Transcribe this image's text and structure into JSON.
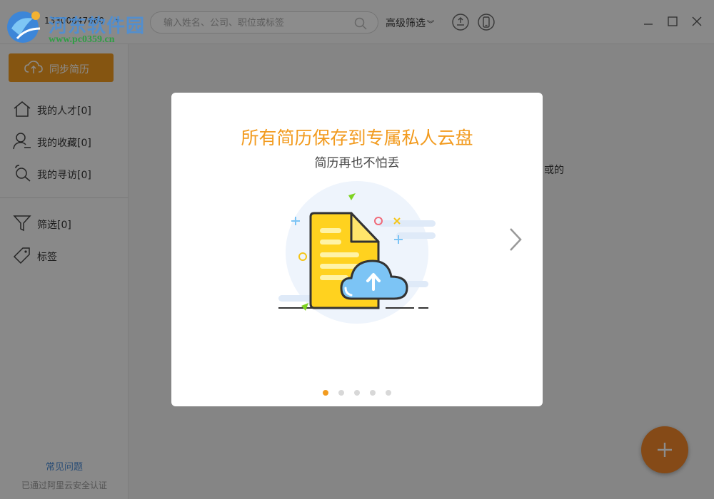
{
  "watermark": {
    "title": "河东软件园",
    "url": "www.pc0359.cn"
  },
  "header": {
    "phone": "13300847660",
    "search_placeholder": "输入姓名、公司、职位或标签",
    "advanced_filter_label": "高级筛选"
  },
  "sidebar": {
    "sync_label": "同步简历",
    "items": [
      {
        "label": "我的人才[0]",
        "icon": "home-icon"
      },
      {
        "label": "我的收藏[0]",
        "icon": "user-icon"
      },
      {
        "label": "我的寻访[0]",
        "icon": "search-person-icon"
      },
      {
        "label": "筛选[0]",
        "icon": "filter-icon"
      },
      {
        "label": "标签",
        "icon": "tag-icon"
      }
    ],
    "faq_label": "常见问题",
    "cert_label": "已通过阿里云安全认证"
  },
  "main": {
    "partial_text": "或的"
  },
  "modal": {
    "title": "所有简历保存到专属私人云盘",
    "subtitle": "简历再也不怕丢",
    "slide_count": 5,
    "active_slide": 1
  },
  "colors": {
    "accent": "#f29b1f",
    "fab": "#f2872a",
    "link": "#4a8bd6"
  }
}
